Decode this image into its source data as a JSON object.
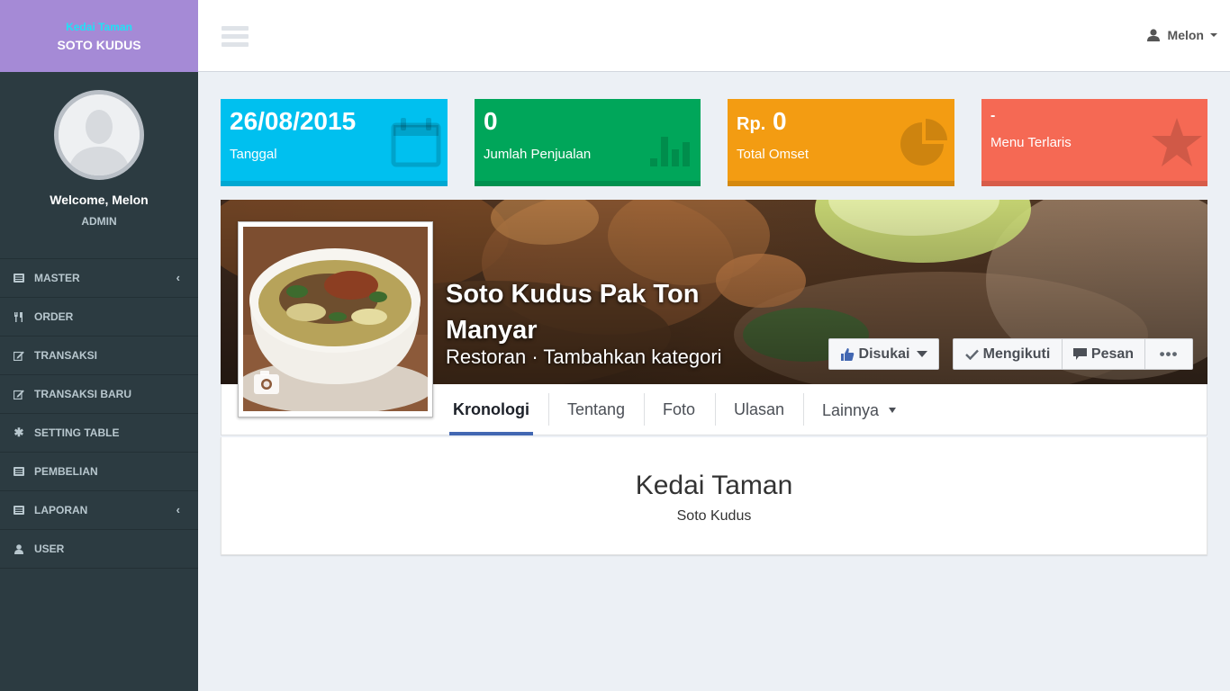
{
  "brand": {
    "subtitle": "Kedai Taman",
    "title": "SOTO KUDUS"
  },
  "user_panel": {
    "welcome": "Welcome, Melon",
    "role": "ADMIN"
  },
  "sidebar": {
    "items": [
      {
        "label": "MASTER",
        "icon": "list-icon",
        "has_submenu": true
      },
      {
        "label": "ORDER",
        "icon": "cutlery-icon",
        "has_submenu": false
      },
      {
        "label": "TRANSAKSI",
        "icon": "edit-icon",
        "has_submenu": false
      },
      {
        "label": "TRANSAKSI BARU",
        "icon": "edit-icon",
        "has_submenu": false
      },
      {
        "label": "SETTING TABLE",
        "icon": "asterisk-icon",
        "has_submenu": false
      },
      {
        "label": "PEMBELIAN",
        "icon": "list-icon",
        "has_submenu": false
      },
      {
        "label": "LAPORAN",
        "icon": "list-icon",
        "has_submenu": true
      },
      {
        "label": "USER",
        "icon": "user-icon",
        "has_submenu": false
      }
    ]
  },
  "topbar": {
    "user_name": "Melon"
  },
  "info_boxes": [
    {
      "value": "26/08/2015",
      "label": "Tanggal",
      "icon": "calendar-icon",
      "color": "#00c0ef"
    },
    {
      "value": "0",
      "label": "Jumlah Penjualan",
      "icon": "bar-chart-icon",
      "color": "#00a65a"
    },
    {
      "prefix": "Rp.",
      "value": "0",
      "label": "Total Omset",
      "icon": "pie-chart-icon",
      "color": "#f39c12"
    },
    {
      "value": "-",
      "label": "Menu Terlaris",
      "icon": "star-icon",
      "color": "#f56954"
    }
  ],
  "profile": {
    "name": "Soto Kudus Pak Ton Manyar",
    "category": "Restoran · Tambahkan kategori",
    "buttons": {
      "like": "Disukai",
      "follow": "Mengikuti",
      "message": "Pesan",
      "more": "•••"
    },
    "tabs": [
      "Kronologi",
      "Tentang",
      "Foto",
      "Ulasan",
      "Lainnya"
    ],
    "active_tab": "Kronologi"
  },
  "content": {
    "title": "Kedai Taman",
    "subtitle": "Soto Kudus"
  },
  "colors": {
    "brand": "#a58ad6",
    "sidebar": "#2c3b41",
    "facebook_blue": "#4267b2"
  }
}
